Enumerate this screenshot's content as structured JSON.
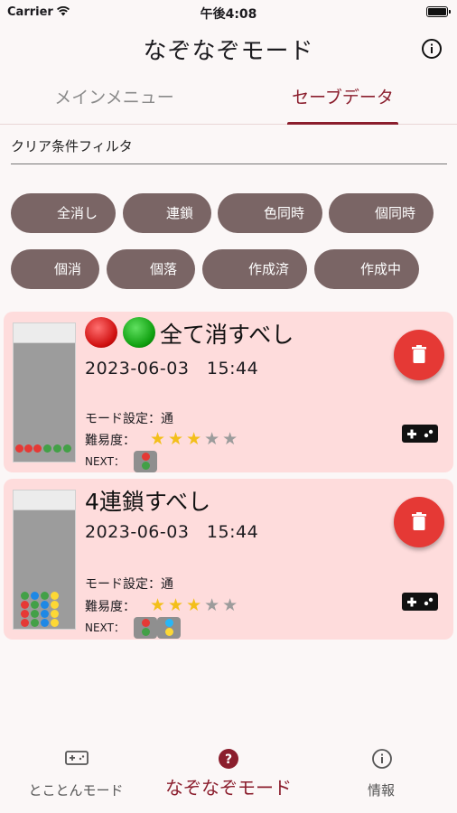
{
  "status": {
    "carrier": "Carrier",
    "time": "午後4:08"
  },
  "appbar": {
    "title": "なぞなぞモード"
  },
  "tabs": [
    {
      "label": "メインメニュー"
    },
    {
      "label": "セーブデータ"
    }
  ],
  "filter": {
    "label": "クリア条件フィルタ",
    "chips": [
      "全消し",
      "連鎖",
      "色同時",
      "個同時",
      "個消",
      "個落",
      "作成済",
      "作成中"
    ]
  },
  "cards": [
    {
      "title": "全て消すべし",
      "date": "2023-06-03　15:44",
      "mode": "モード設定：通",
      "difficulty_label": "難易度：",
      "difficulty": 3,
      "difficulty_max": 5,
      "next_label": "NEXT："
    },
    {
      "title": "4連鎖すべし",
      "date": "2023-06-03　15:44",
      "mode": "モード設定：通",
      "difficulty_label": "難易度：",
      "difficulty": 3,
      "difficulty_max": 5,
      "next_label": "NEXT："
    }
  ],
  "bottomnav": [
    {
      "label": "とことんモード",
      "icon": "gamepad-icon"
    },
    {
      "label": "なぞなぞモード",
      "icon": "help-circle-icon"
    },
    {
      "label": "情報",
      "icon": "info-icon"
    }
  ],
  "colors": {
    "accent": "#8b1e2d",
    "chip": "#7a6565",
    "card": "#fedcdc",
    "fab": "#e53935",
    "star": "#f3bf1a"
  }
}
